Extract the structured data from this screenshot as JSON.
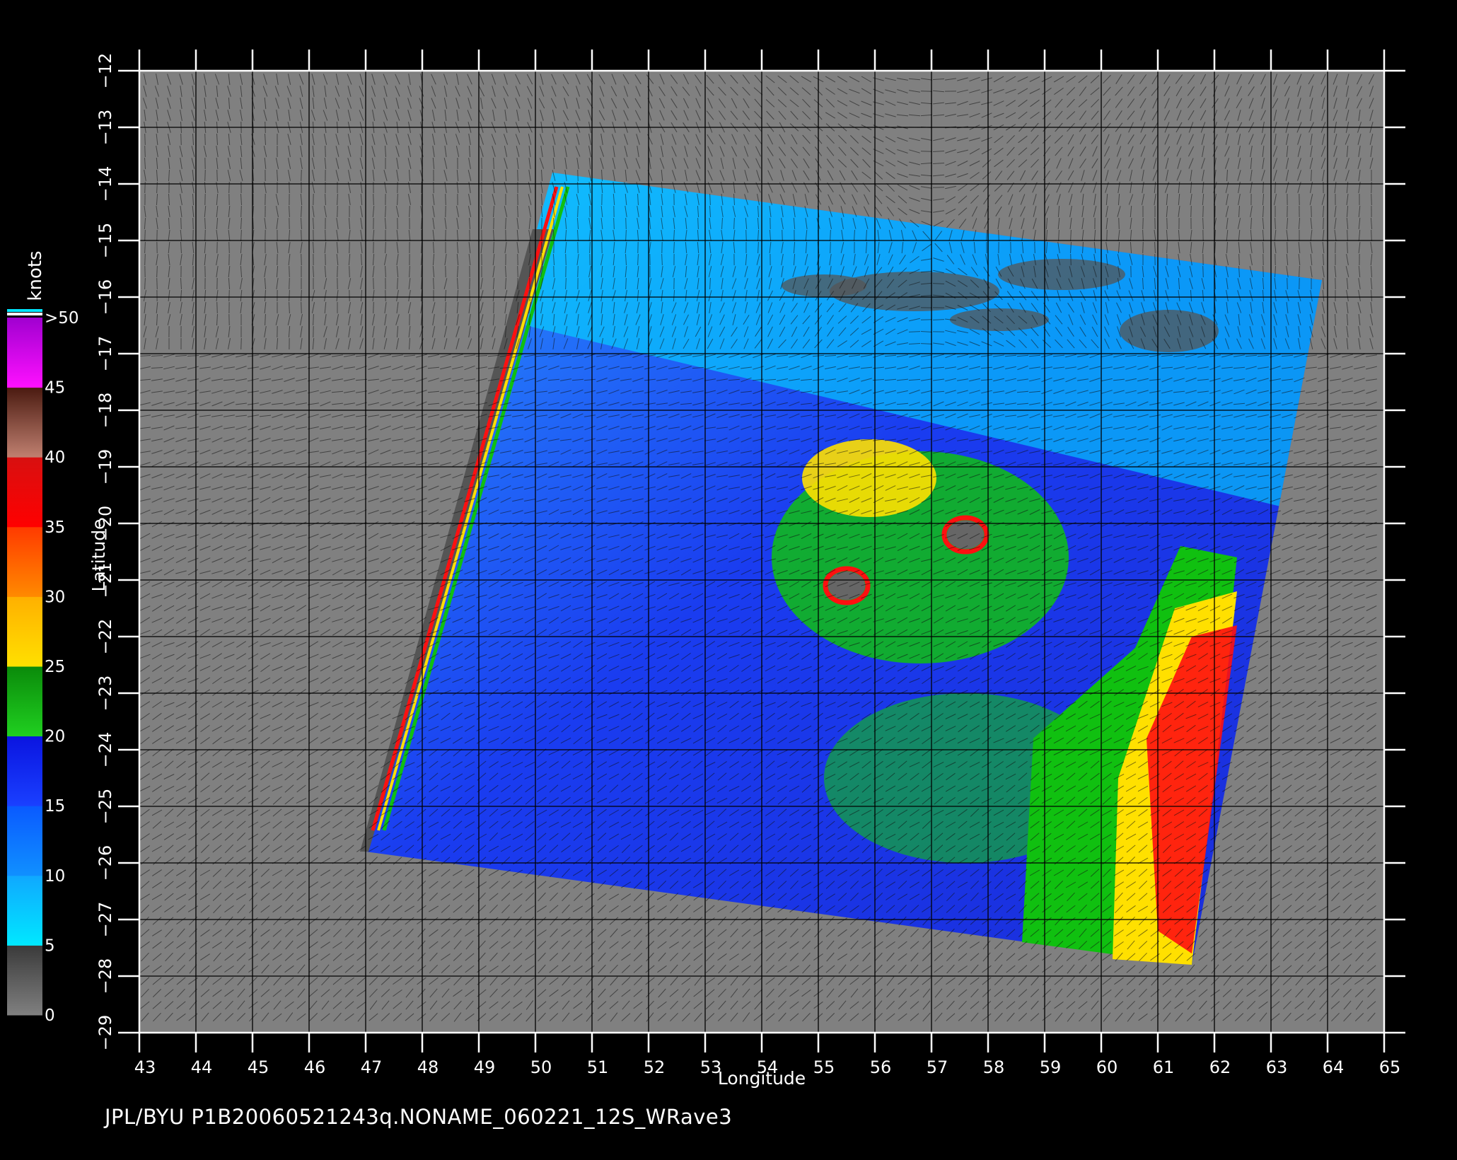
{
  "map": {
    "type": "wind-speed-map",
    "xlabel": "Longitude",
    "ylabel": "Latitude",
    "xlim": [
      43,
      65
    ],
    "ylim": [
      -29,
      -12
    ],
    "x_ticks": [
      "43",
      "44",
      "45",
      "46",
      "47",
      "48",
      "49",
      "50",
      "51",
      "52",
      "53",
      "54",
      "55",
      "56",
      "57",
      "58",
      "59",
      "60",
      "61",
      "62",
      "63",
      "64",
      "65"
    ],
    "y_ticks": [
      "−12",
      "−13",
      "−14",
      "−15",
      "−16",
      "−17",
      "−18",
      "−19",
      "−20",
      "−21",
      "−22",
      "−23",
      "−24",
      "−25",
      "−26",
      "−27",
      "−28",
      "−29"
    ],
    "grid": true,
    "swath_corners_lonlat": [
      [
        50.3,
        -13.8
      ],
      [
        63.9,
        -15.7
      ],
      [
        61.6,
        -27.8
      ],
      [
        47.0,
        -25.8
      ]
    ],
    "land_masses": [
      {
        "name": "madagascar-coast",
        "lon": 49.2,
        "lat": -19.5
      },
      {
        "name": "la-reunion",
        "lon": 55.5,
        "lat": -21.1
      },
      {
        "name": "mauritius",
        "lon": 57.6,
        "lat": -20.2
      }
    ]
  },
  "colorbar": {
    "title": "knots",
    "range": [
      0,
      50
    ],
    "labels": [
      "0",
      "5",
      "10",
      "15",
      "20",
      "25",
      "30",
      "35",
      "40",
      "45",
      ">50"
    ],
    "colors": {
      "c0": "#555555",
      "c5": "#00e6ff",
      "c10": "#0a78ff",
      "c15": "#1010ee",
      "c20": "#10c010",
      "c25": "#ffe000",
      "c30": "#ff6000",
      "c35": "#ff1010",
      "c40": "#7a2a20",
      "c45": "#ff00ff",
      "c50": "#8000c0"
    }
  },
  "footer": "JPL/BYU  P1B20060521243q.NONAME_060221_12S_WRave3"
}
